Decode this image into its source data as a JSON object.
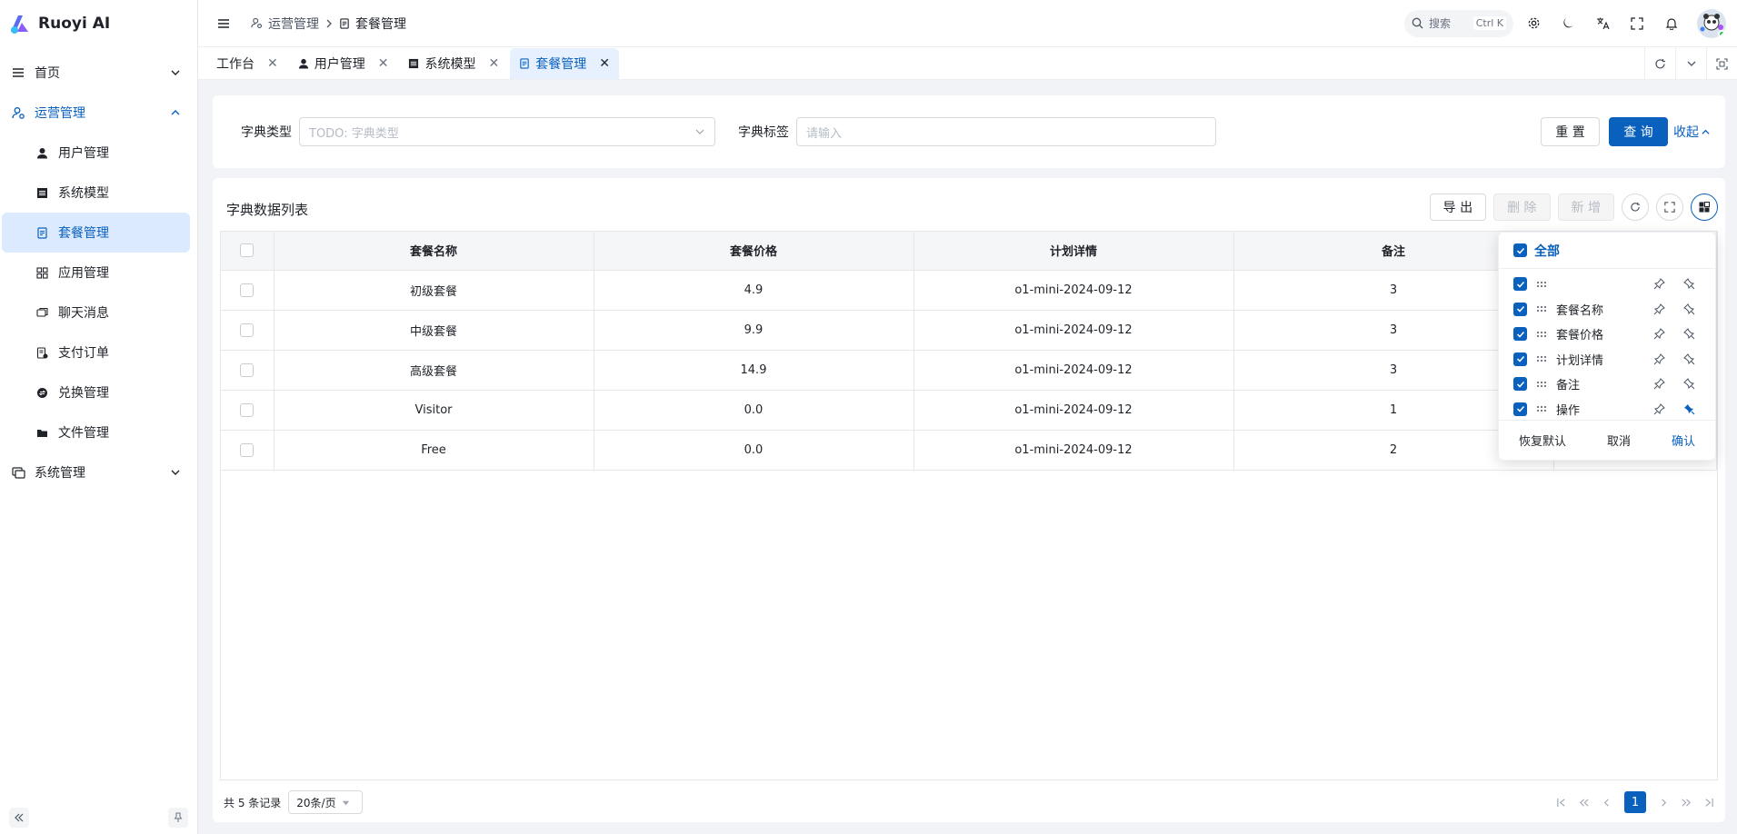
{
  "app": {
    "title": "Ruoyi AI"
  },
  "sidebar": {
    "items": [
      {
        "label": "首页",
        "icon": "menu-lines-icon"
      },
      {
        "label": "运营管理",
        "icon": "user-gear-icon"
      },
      {
        "label": "系统管理",
        "icon": "monitor-icon"
      }
    ],
    "subitems": [
      {
        "label": "用户管理",
        "icon": "user-icon"
      },
      {
        "label": "系统模型",
        "icon": "list-box-icon"
      },
      {
        "label": "套餐管理",
        "icon": "document-icon"
      },
      {
        "label": "应用管理",
        "icon": "grid-apps-icon"
      },
      {
        "label": "聊天消息",
        "icon": "chat-icon"
      },
      {
        "label": "支付订单",
        "icon": "receipt-icon"
      },
      {
        "label": "兑换管理",
        "icon": "exchange-icon"
      },
      {
        "label": "文件管理",
        "icon": "folder-icon"
      }
    ]
  },
  "header": {
    "breadcrumb": [
      "运营管理",
      "套餐管理"
    ],
    "search_label": "搜索",
    "search_shortcut": "Ctrl K"
  },
  "tabs": [
    {
      "label": "工作台"
    },
    {
      "label": "用户管理"
    },
    {
      "label": "系统模型"
    },
    {
      "label": "套餐管理"
    }
  ],
  "filter": {
    "type_label": "字典类型",
    "type_placeholder": "TODO: 字典类型",
    "tag_label": "字典标签",
    "tag_placeholder": "请输入",
    "reset": "重 置",
    "query": "查 询",
    "collapse": "收起"
  },
  "table": {
    "title": "字典数据列表",
    "toolbar": {
      "export": "导 出",
      "delete": "删 除",
      "add": "新 增"
    },
    "columns": [
      "套餐名称",
      "套餐价格",
      "计划详情",
      "备注"
    ],
    "rows": [
      [
        "初级套餐",
        "4.9",
        "o1-mini-2024-09-12",
        "3"
      ],
      [
        "中级套餐",
        "9.9",
        "o1-mini-2024-09-12",
        "3"
      ],
      [
        "高级套餐",
        "14.9",
        "o1-mini-2024-09-12",
        "3"
      ],
      [
        "Visitor",
        "0.0",
        "o1-mini-2024-09-12",
        "1"
      ],
      [
        "Free",
        "0.0",
        "o1-mini-2024-09-12",
        "2"
      ]
    ]
  },
  "pager": {
    "total": "共 5 条记录",
    "size": "20条/页",
    "current": "1"
  },
  "column_settings": {
    "all": "全部",
    "rows": [
      "",
      "套餐名称",
      "套餐价格",
      "计划详情",
      "备注",
      "操作"
    ],
    "reset": "恢复默认",
    "cancel": "取消",
    "confirm": "确认"
  },
  "colors": {
    "primary": "#0960bd",
    "selected_bg": "#dbeafe"
  }
}
